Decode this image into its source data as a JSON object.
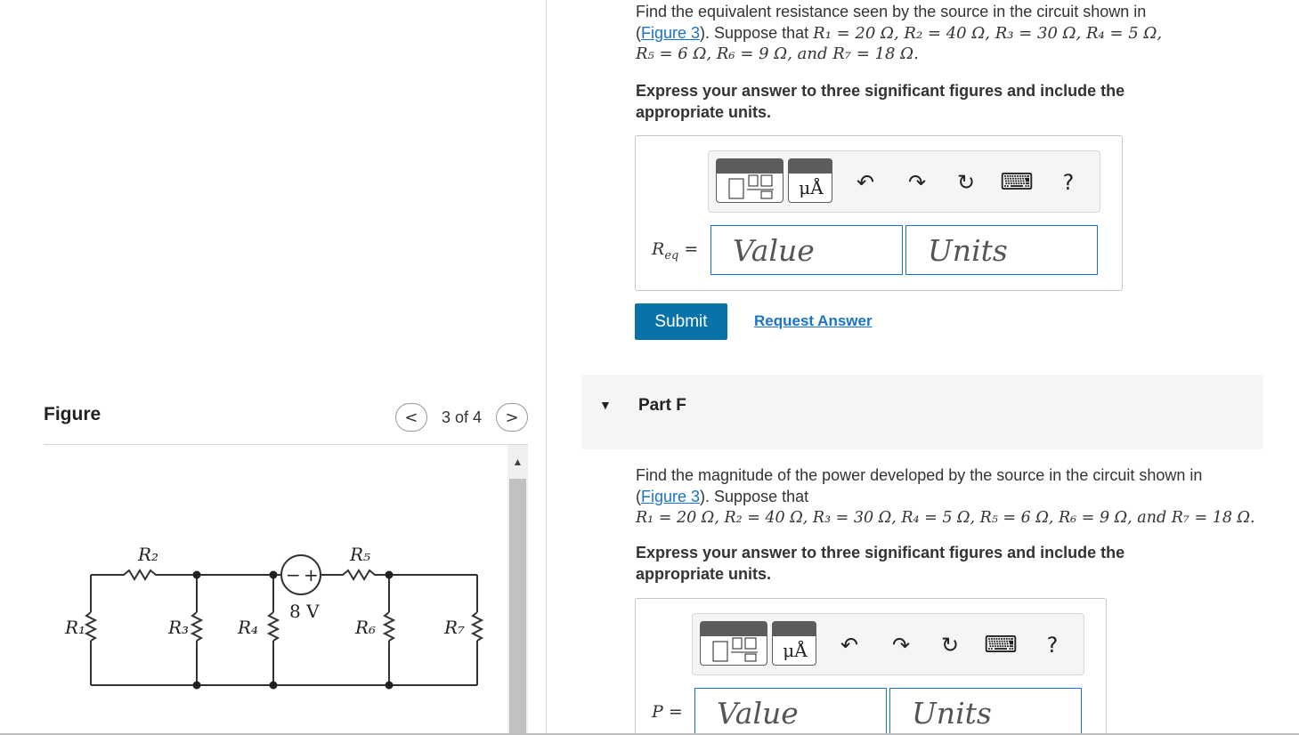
{
  "partE": {
    "problem_pre": "Find the equivalent resistance seen by the source in the circuit shown in",
    "figure_link": "Figure 3",
    "problem_mid": "). Suppose that ",
    "problem_vals_line1": "R₁ = 20 Ω, R₂ = 40 Ω, R₃ = 30 Ω, R₄ = 5 Ω,",
    "problem_vals_line2": "R₅ = 6 Ω, R₆ = 9 Ω, and R₇ = 18 Ω.",
    "instruction": "Express your answer to three significant figures and include the appropriate units.",
    "label": "Req =",
    "value_placeholder": "Value",
    "units_placeholder": "Units"
  },
  "toolbar": {
    "units_btn": "μÅ",
    "undo": "↶",
    "redo": "↷",
    "reset": "↻",
    "keyboard": "⌨",
    "help": "?"
  },
  "actions": {
    "submit": "Submit",
    "request": "Request Answer"
  },
  "partF": {
    "title": "Part F",
    "caret": "▼",
    "problem_pre": "Find the magnitude of the power developed by the source in the circuit shown in",
    "figure_link": "Figure 3",
    "problem_mid": "). Suppose that",
    "problem_vals": "R₁ = 20 Ω, R₂ = 40 Ω, R₃ = 30 Ω, R₄ = 5 Ω, R₅ = 6 Ω, R₆ = 9 Ω, and R₇ = 18 Ω.",
    "instruction": "Express your answer to three significant figures and include the appropriate units.",
    "label": "P =",
    "value_placeholder": "Value",
    "units_placeholder": "Units"
  },
  "figure": {
    "title": "Figure",
    "pager_count": "3 of 4",
    "prev": "<",
    "next": ">",
    "labels": {
      "R1": "R₁",
      "R2": "R₂",
      "R3": "R₃",
      "R4": "R₄",
      "R5": "R₅",
      "R6": "R₆",
      "R7": "R₇",
      "source": "8 V",
      "minus": "−",
      "plus": "+"
    }
  }
}
